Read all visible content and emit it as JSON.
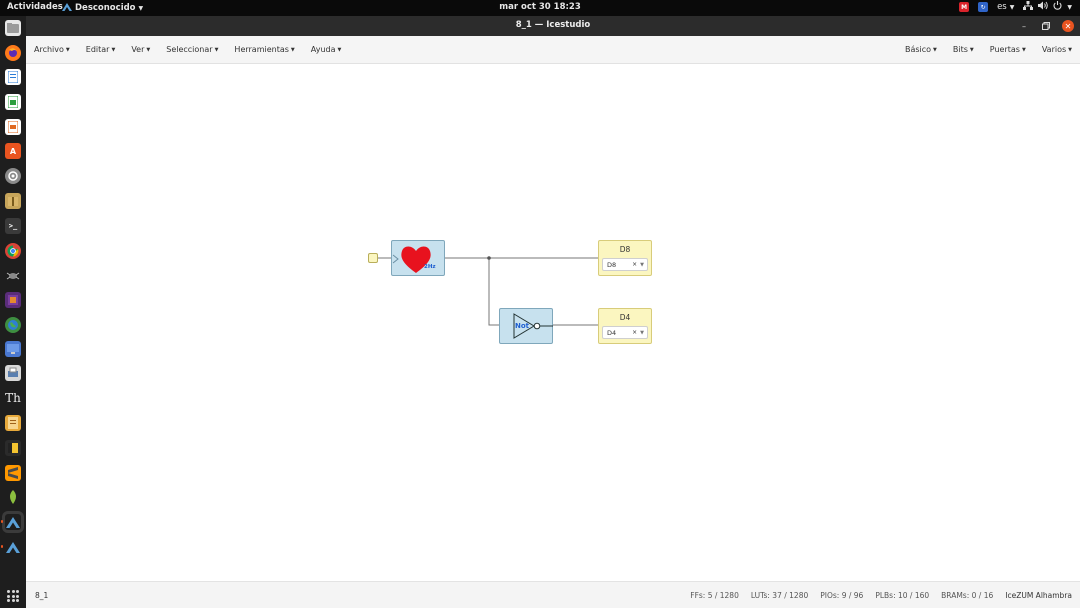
{
  "topbar": {
    "activities": "Actividades",
    "app_name": "Desconocido",
    "clock": "mar oct 30  18:23",
    "lang": "es"
  },
  "window": {
    "title": "8_1 — Icestudio"
  },
  "menubar": {
    "left": [
      "Archivo",
      "Editar",
      "Ver",
      "Seleccionar",
      "Herramientas",
      "Ayuda"
    ],
    "right": [
      "Básico",
      "Bits",
      "Puertas",
      "Varios"
    ]
  },
  "circuit": {
    "heart_label": "2Hz",
    "not_label": "Not",
    "output_d8": {
      "name": "D8",
      "pin": "D8"
    },
    "output_d4": {
      "name": "D4",
      "pin": "D4"
    }
  },
  "statusbar": {
    "file": "8_1",
    "ffs": "FFs:  5 / 1280",
    "luts": "LUTs:  37 / 1280",
    "pios": "PIOs:  9 / 96",
    "plbs": "PLBs:  10 / 160",
    "brams": "BRAMs:  0 / 16",
    "board": "IceZUM Alhambra"
  },
  "colors": {
    "accent": "#e95420",
    "block_blue": "#c7e1ee",
    "block_yellow": "#fbf6c0",
    "heart": "#e8121e",
    "not_label": "#1f5fd0"
  },
  "dock_icons": [
    "files-icon",
    "firefox-icon",
    "writer-icon",
    "calc-icon",
    "impress-icon",
    "software-center-icon",
    "settings-icon",
    "archive-icon",
    "terminal-icon",
    "chrome-icon",
    "bug-icon",
    "gallery-icon",
    "earth-icon",
    "screen-icon",
    "scanner-icon",
    "font-icon",
    "document-icon",
    "notes-icon",
    "sublime-icon",
    "leaf-icon",
    "icestudio-icon",
    "icestudio-alt-icon",
    "apps-grid-icon"
  ]
}
